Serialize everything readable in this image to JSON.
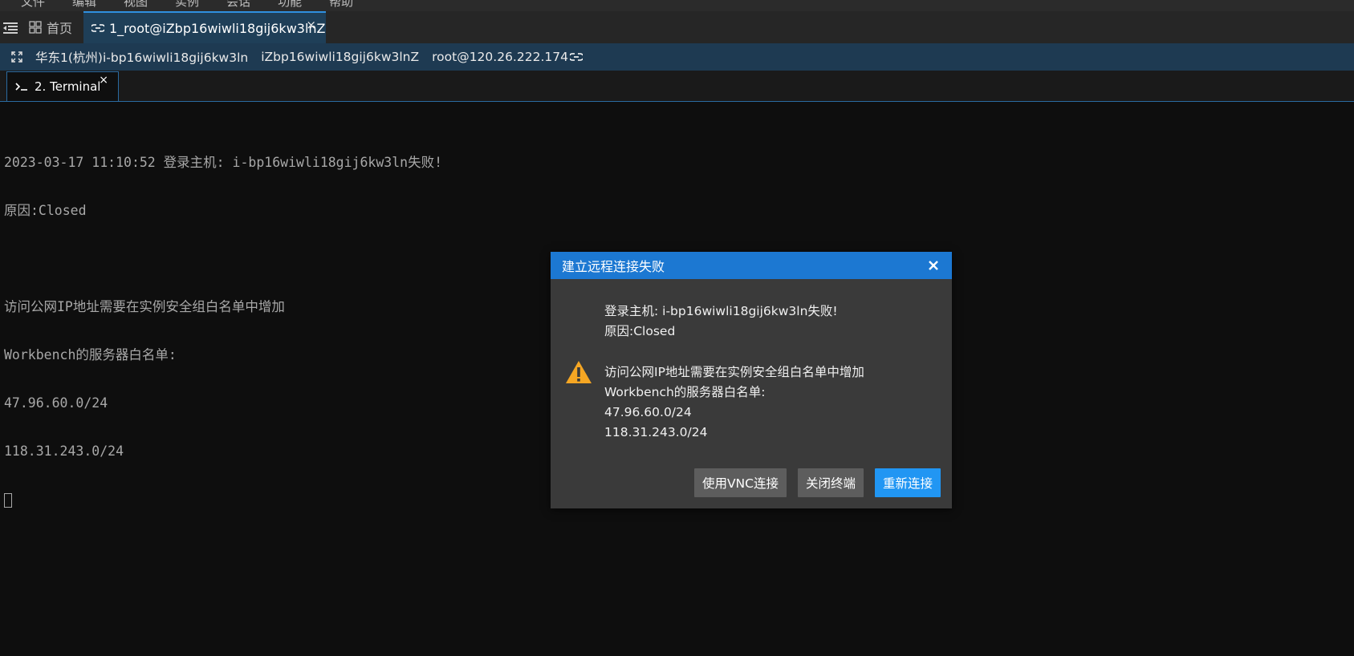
{
  "menubar": {
    "items": [
      "文件",
      "编辑",
      "视图",
      "实例",
      "会话",
      "功能",
      "帮助"
    ]
  },
  "tabs": {
    "home_label": "首页",
    "session_label": "1_root@iZbp16wiwli18gij6kw3lnZ",
    "close_glyph": "×"
  },
  "infobar": {
    "region_instance": "华东1(杭州)i-bp16wiwli18gij6kw3ln",
    "hostname": "iZbp16wiwli18gij6kw3lnZ",
    "user_ip": "root@120.26.222.174"
  },
  "subtabs": {
    "terminal_label": "2. Terminal",
    "close_glyph": "×"
  },
  "terminal": {
    "lines": [
      "2023-03-17 11:10:52 登录主机: i-bp16wiwli18gij6kw3ln失败!",
      "原因:Closed",
      "",
      "访问公网IP地址需要在实例安全组白名单中增加",
      "Workbench的服务器白名单:",
      "47.96.60.0/24",
      "118.31.243.0/24"
    ]
  },
  "dialog": {
    "title": "建立远程连接失败",
    "message_lines_1": [
      "登录主机: i-bp16wiwli18gij6kw3ln失败!",
      "原因:Closed"
    ],
    "message_lines_2": [
      "访问公网IP地址需要在实例安全组白名单中增加",
      "Workbench的服务器白名单:",
      "47.96.60.0/24",
      "118.31.243.0/24"
    ],
    "buttons": {
      "vnc": "使用VNC连接",
      "close_terminal": "关闭终端",
      "reconnect": "重新连接"
    }
  },
  "colors": {
    "accent": "#1c78d2",
    "primary_button": "#2196f3",
    "warning": "#f5a623"
  }
}
